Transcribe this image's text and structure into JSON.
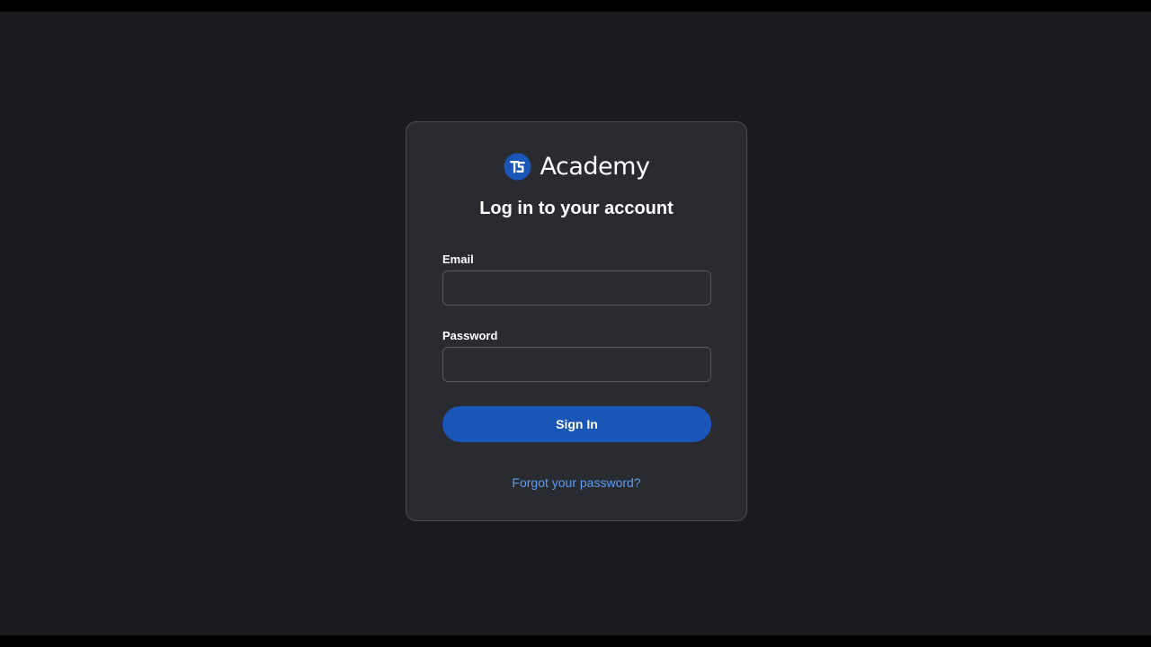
{
  "brand": {
    "name": "Academy",
    "logo_icon": "academy-logo-icon",
    "logo_color": "#1a56b8"
  },
  "login": {
    "title": "Log in to your account",
    "email_label": "Email",
    "email_value": "",
    "password_label": "Password",
    "password_value": "",
    "submit_label": "Sign In",
    "forgot_label": "Forgot your password?"
  },
  "colors": {
    "background": "#1a1c20",
    "card": "#2a2b30",
    "accent": "#1a56b8",
    "link": "#5b9cf0"
  }
}
